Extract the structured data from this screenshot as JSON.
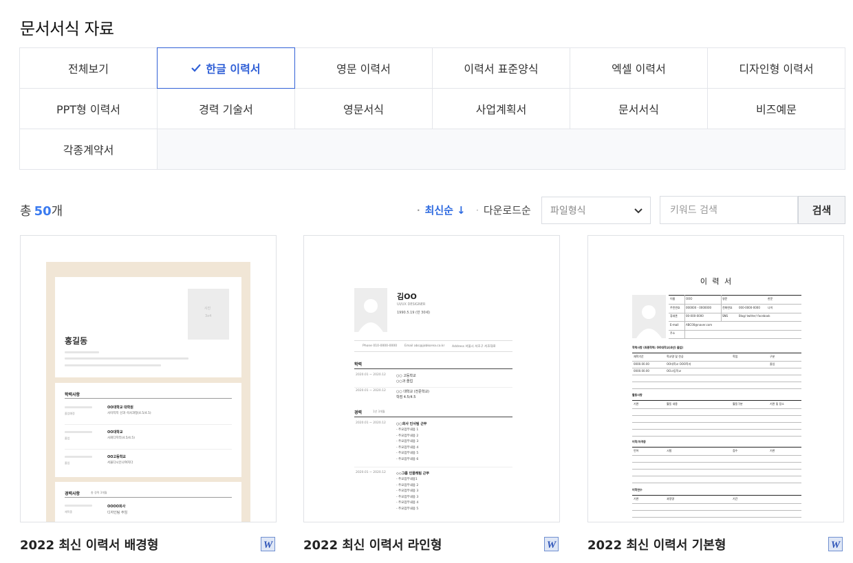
{
  "page": {
    "title": "문서서식 자료"
  },
  "categories": [
    {
      "label": "전체보기",
      "active": false
    },
    {
      "label": "한글 이력서",
      "active": true
    },
    {
      "label": "영문 이력서",
      "active": false
    },
    {
      "label": "이력서 표준양식",
      "active": false
    },
    {
      "label": "엑셀 이력서",
      "active": false
    },
    {
      "label": "디자인형 이력서",
      "active": false
    },
    {
      "label": "PPT형 이력서",
      "active": false
    },
    {
      "label": "경력 기술서",
      "active": false
    },
    {
      "label": "영문서식",
      "active": false
    },
    {
      "label": "사업계획서",
      "active": false
    },
    {
      "label": "문서서식",
      "active": false
    },
    {
      "label": "비즈예문",
      "active": false
    },
    {
      "label": "각종계약서",
      "active": false
    }
  ],
  "toolbar": {
    "total_prefix": "총",
    "total_count": "50",
    "total_suffix": "개",
    "sort_latest": "최신순",
    "sort_latest_arrow": "↓",
    "sort_downloads": "다운로드순",
    "file_type_placeholder": "파일형식",
    "search_placeholder": "키워드 검색",
    "search_button": "검색"
  },
  "cards": [
    {
      "title": "2022 최신 이력서 배경형",
      "file_icon": "word-doc-icon"
    },
    {
      "title": "2022 최신 이력서 라인형",
      "file_icon": "word-doc-icon"
    },
    {
      "title": "2022 최신 이력서 기본형",
      "file_icon": "word-doc-icon"
    }
  ],
  "thumb1": {
    "photo_label": "사진",
    "photo_size": "3x4",
    "name": "홍길동",
    "section_edu": "학력사항",
    "edu_rows": [
      {
        "school": "OO대학교 대학원",
        "desc": "사이지지 선과 석사과정(4.5/4.5)",
        "status": "졸업예정"
      },
      {
        "school": "OO대학교",
        "desc": "사회다지터(4.5/4.5)",
        "status": "졸업"
      },
      {
        "school": "OO고등학교",
        "desc": "서울다시인나여지다",
        "status": "졸업"
      }
    ],
    "section_career": "경력사항",
    "career_note": "총 경력 3개월",
    "career_company": "OOOO회사",
    "career_team": "디자인팀 주임",
    "career_role": "재직중"
  },
  "thumb2": {
    "name": "김OO",
    "subtitle": "UI/UX DESIGNER",
    "birth": "1990.5.19 (만 30세)",
    "contact_phone": "Phone 010-0000-0000",
    "contact_email": "Email abc@jobkorea.co.kr",
    "contact_address": "Address  서울시 서초구 서초대로",
    "section_edu": "학력",
    "edu_rows": [
      {
        "date": "2020.01 ~ 2020.12",
        "lines": [
          "○○ 고등학교",
          "○○과 졸업"
        ]
      },
      {
        "date": "2020.01 ~ 2020.12",
        "lines": [
          "○○ 대학교 (전문학교)",
          "학점 4.5/4.5"
        ]
      }
    ],
    "section_career": "경력",
    "career_note": "1년 3개월",
    "career_rows": [
      {
        "date": "2020.01 ~ 2020.12",
        "company": "○○회사 인사팀 근무",
        "items": [
          "- 주요업무내용 1",
          "- 주요업무내용 2",
          "- 주요업무내용 3",
          "- 주요업무내용 4",
          "- 주요업무내용 5",
          "- 주요업무내용 6"
        ]
      },
      {
        "date": "2020.01 ~ 2020.12",
        "company": "◇◇그룹 인플레팀 근무",
        "items": [
          "- 주요업무내용1",
          "- 주요업무내용 2",
          "- 주요업무내용 3",
          "- 주요업무내용 3",
          "- 주요업무내용 4",
          "- 주요업무내용 5"
        ]
      }
    ]
  },
  "thumb3": {
    "title": "이 력 서",
    "info_labels": [
      "이름",
      "주민번호",
      "휴대폰",
      "E-mail",
      "주소"
    ],
    "info_values": [
      "OOO",
      "000000 - 0000000",
      "00-000-0000",
      "ABC00@naver.com",
      ""
    ],
    "info_labels2": [
      "영문",
      "전화번호",
      "SNS"
    ],
    "info_values2": [
      "",
      "000-0000-0000",
      "Blog/ twitter/ facebook"
    ],
    "extra_labels": [
      "한문",
      "나이"
    ],
    "section_edu": "학력사항 (최종학력: OO대학교(4년) 졸업)",
    "edu_headers": [
      "재학기간",
      "학교명 및 전공",
      "학점",
      "구분"
    ],
    "edu_rows": [
      [
        "0000.00.00",
        "OO대학교 OOO학과",
        "",
        "졸업"
      ],
      [
        "0000.00.00",
        "OO고등학교",
        "",
        ""
      ]
    ],
    "section_activity": "활동사항",
    "activity_headers": [
      "기관",
      "활동 내용",
      "활동구분",
      "기관 및 장소"
    ],
    "section_lang": "어학/자격증",
    "lang_headers": [
      "언어",
      "시험",
      "점수",
      "기관"
    ],
    "section_training": "어학연수",
    "training_headers": [
      "기관",
      "과정명",
      "기간"
    ]
  }
}
